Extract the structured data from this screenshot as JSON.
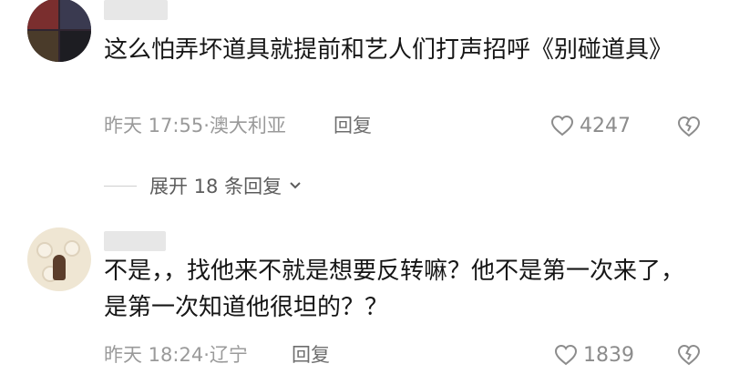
{
  "comments": [
    {
      "text": "这么怕弄坏道具就提前和艺人们打声招呼《别碰道具》",
      "time_location": "昨天 17:55·澳大利亚",
      "reply_label": "回复",
      "like_count": "4247",
      "expand_replies": "展开 18 条回复"
    },
    {
      "text": "不是，，找他来不就是想要反转嘛？他不是第一次来了，是第一次知道他很坦的？？",
      "time_location": "昨天 18:24·辽宁",
      "reply_label": "回复",
      "like_count": "1839"
    }
  ],
  "icons": {
    "like": "heart-icon",
    "dislike": "broken-heart-icon",
    "expand": "chevron-down-icon"
  }
}
